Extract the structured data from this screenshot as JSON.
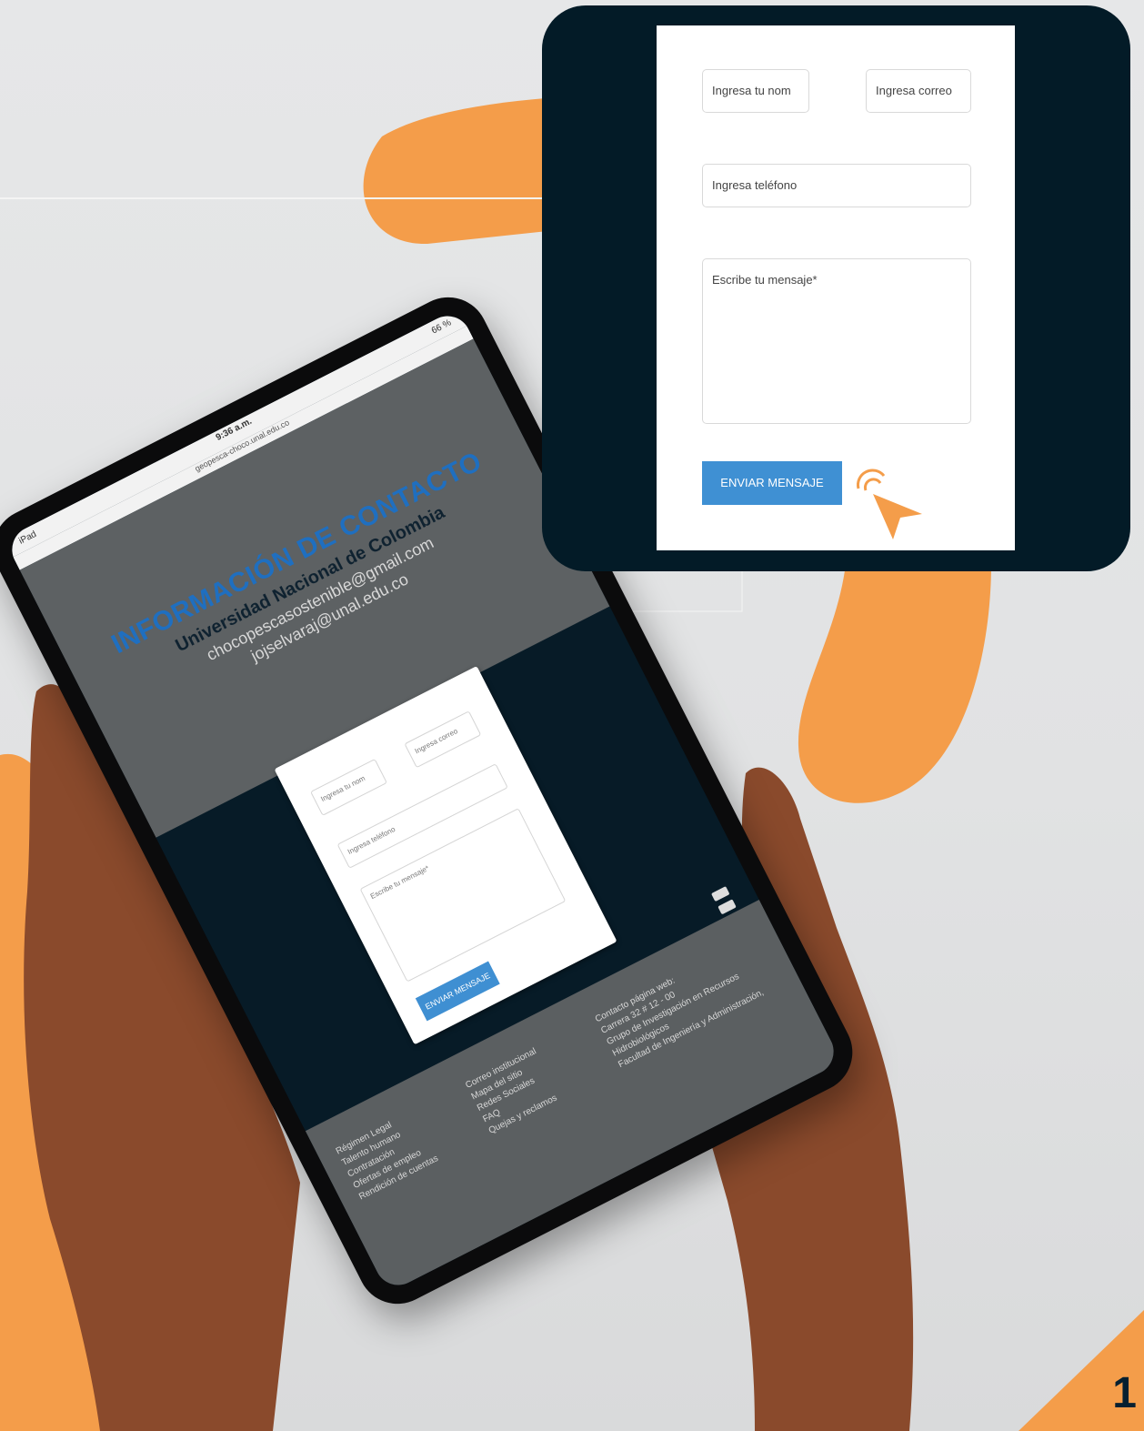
{
  "tablet": {
    "status": {
      "device": "iPad",
      "time": "9:36 a.m.",
      "battery": "66 %"
    },
    "url": "geopesca-choco.unal.edu.co",
    "header": {
      "title": "INFORMACIÓN DE CONTACTO",
      "university": "Universidad Nacional de Colombia",
      "email_1": "chocopescasostenible@gmail.com",
      "email_2": "jojselvaraj@unal.edu.co"
    },
    "form": {
      "name_placeholder": "Ingresa tu nom",
      "email_placeholder": "Ingresa correo",
      "phone_placeholder": "Ingresa teléfono",
      "message_placeholder": "Escribe tu mensaje*",
      "submit_label": "ENVIAR MENSAJE"
    },
    "footer": {
      "col1": [
        "Régimen Legal",
        "Talento humano",
        "Contratación",
        "Ofertas de empleo",
        "Rendición de cuentas"
      ],
      "col2": [
        "Correo institucional",
        "Mapa del sitio",
        "Redes Sociales",
        "FAQ",
        "Quejas y reclamos"
      ],
      "col3": [
        "Contacto página web:",
        "Carrera 32 # 12 - 00",
        "Grupo de Investigación en Recursos",
        "Hidrobiológicos",
        "Facultad de Ingeniería y Administración,"
      ]
    }
  },
  "zoom": {
    "name_placeholder": "Ingresa tu nom",
    "email_placeholder": "Ingresa correo",
    "phone_placeholder": "Ingresa teléfono",
    "message_placeholder": "Escribe tu mensaje*",
    "submit_label": "ENVIAR MENSAJE"
  },
  "page_number": "1",
  "colors": {
    "accent_orange": "#f49d4a",
    "panel_navy": "#031b27",
    "button_blue": "#3f90d3"
  }
}
